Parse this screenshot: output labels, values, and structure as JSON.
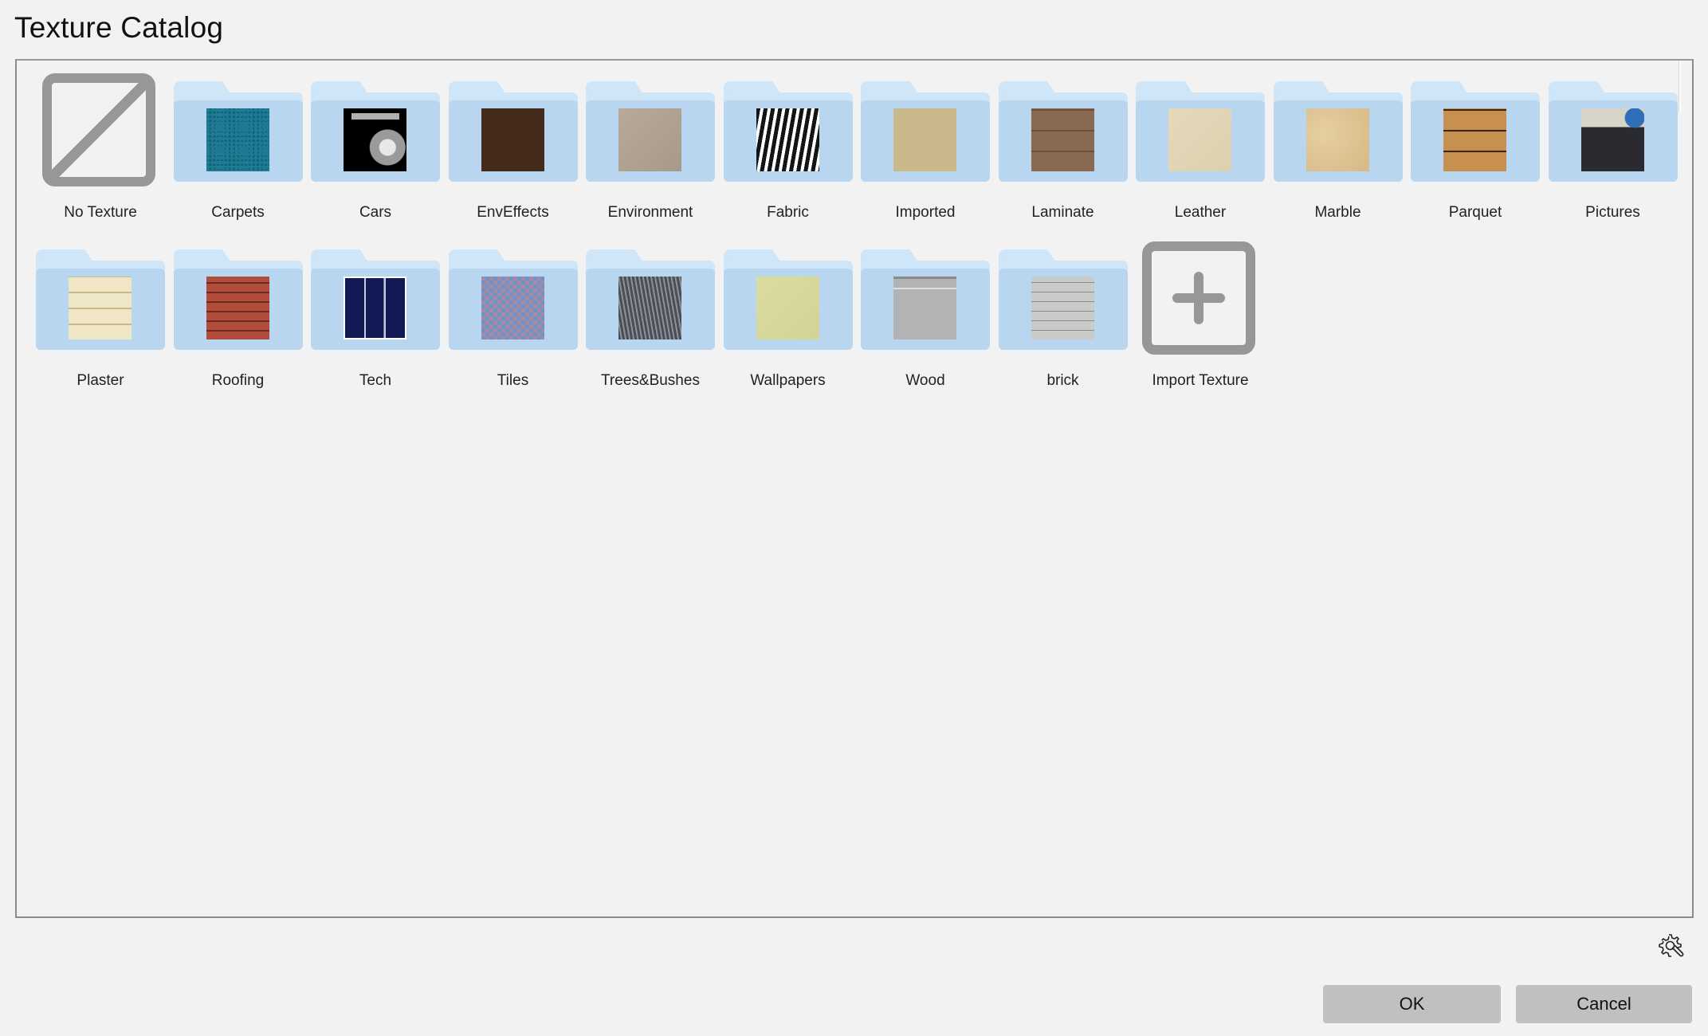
{
  "window": {
    "title": "Texture Catalog"
  },
  "catalog": {
    "items": [
      {
        "label": "No Texture",
        "type": "none",
        "icon": "no-texture-icon"
      },
      {
        "label": "Carpets",
        "type": "folder",
        "thumb": "carpets",
        "colors": [
          "#1f7a93",
          "#136074"
        ]
      },
      {
        "label": "Cars",
        "type": "folder",
        "thumb": "cars",
        "colors": [
          "#000000",
          "#b0b0b0"
        ]
      },
      {
        "label": "EnvEffects",
        "type": "folder",
        "thumb": "enveffects",
        "colors": [
          "#452b1b",
          "#452b1b"
        ]
      },
      {
        "label": "Environment",
        "type": "folder",
        "thumb": "environment",
        "colors": [
          "#b8aa98",
          "#a89988"
        ]
      },
      {
        "label": "Fabric",
        "type": "folder",
        "thumb": "fabric",
        "colors": [
          "#141414",
          "#ffffff"
        ]
      },
      {
        "label": "Imported",
        "type": "folder",
        "thumb": "imported",
        "colors": [
          "#5a6573",
          "#c9b98a"
        ]
      },
      {
        "label": "Laminate",
        "type": "folder",
        "thumb": "laminate",
        "colors": [
          "#8a6a52",
          "#6d533f"
        ]
      },
      {
        "label": "Leather",
        "type": "folder",
        "thumb": "leather",
        "colors": [
          "#e6d9ba",
          "#ddd0af"
        ]
      },
      {
        "label": "Marble",
        "type": "folder",
        "thumb": "marble",
        "colors": [
          "#e6cfa2",
          "#d6b985"
        ]
      },
      {
        "label": "Parquet",
        "type": "folder",
        "thumb": "parquet",
        "colors": [
          "#c8904e",
          "#3a2412"
        ]
      },
      {
        "label": "Pictures",
        "type": "folder",
        "thumb": "pictures",
        "colors": [
          "#d8d4c8",
          "#2a2a30"
        ]
      },
      {
        "label": "Plaster",
        "type": "folder",
        "thumb": "plaster",
        "colors": [
          "#efe6c6",
          "#c9b98a"
        ]
      },
      {
        "label": "Roofing",
        "type": "folder",
        "thumb": "roofing",
        "colors": [
          "#b24c3a",
          "#6b2a22"
        ]
      },
      {
        "label": "Tech",
        "type": "folder",
        "thumb": "tech",
        "colors": [
          "#121a56",
          "#c7cbe0"
        ]
      },
      {
        "label": "Tiles",
        "type": "folder",
        "thumb": "tiles",
        "colors": [
          "#6f93c8",
          "#a58aa2"
        ]
      },
      {
        "label": "Trees&Bushes",
        "type": "folder",
        "thumb": "trees",
        "colors": [
          "#4a4e56",
          "#8c9099"
        ]
      },
      {
        "label": "Wallpapers",
        "type": "folder",
        "thumb": "wallpapers",
        "colors": [
          "#dbdc9e",
          "#d3d398"
        ]
      },
      {
        "label": "Wood",
        "type": "folder",
        "thumb": "wood",
        "colors": [
          "#b3b3b3",
          "#8a8a8a"
        ]
      },
      {
        "label": "brick",
        "type": "folder",
        "thumb": "brick",
        "colors": [
          "#c8cbc8",
          "#9fb6b0"
        ]
      },
      {
        "label": "Import Texture",
        "type": "import",
        "icon": "plus-icon"
      }
    ]
  },
  "footer": {
    "settings_icon": "gear-wrench-icon",
    "ok_label": "OK",
    "cancel_label": "Cancel"
  }
}
